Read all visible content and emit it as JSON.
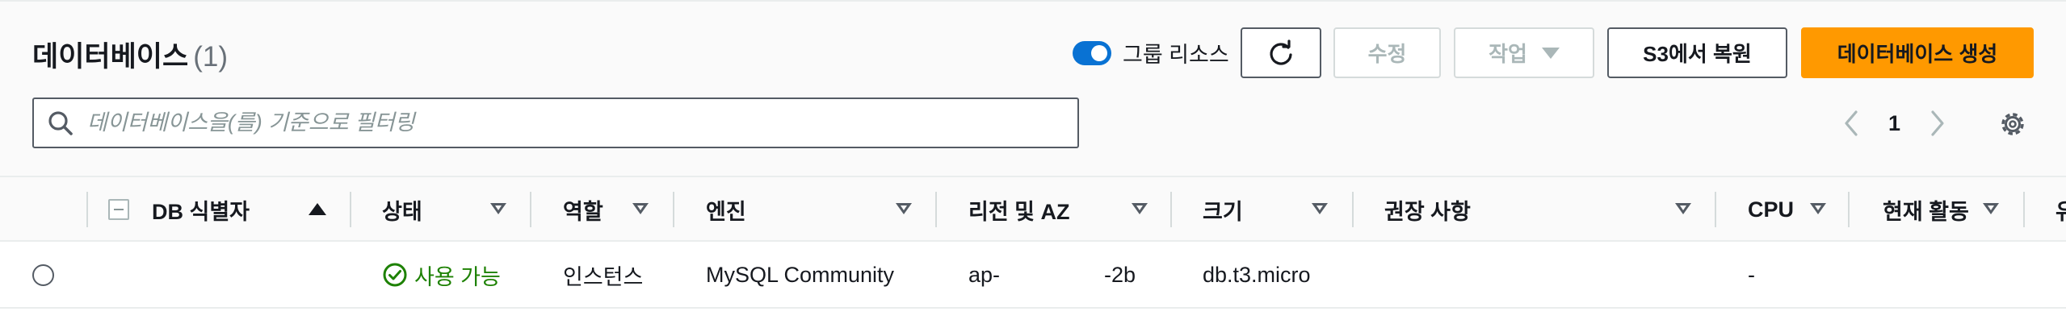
{
  "header": {
    "title": "데이터베이스",
    "count": "(1)",
    "group_toggle_label": "그룹 리소스",
    "refresh_icon": "refresh-icon",
    "modify_label": "수정",
    "actions_label": "작업",
    "restore_s3_label": "S3에서 복원",
    "create_label": "데이터베이스 생성",
    "accent_color": "#ff9900",
    "toggle_color": "#0972d3"
  },
  "search": {
    "placeholder": "데이터베이스을(를) 기준으로 필터링",
    "value": ""
  },
  "pagination": {
    "current_page": "1"
  },
  "table": {
    "columns": [
      "DB 식별자",
      "상태",
      "역할",
      "엔진",
      "리전 및 AZ",
      "크기",
      "권장 사항",
      "CPU",
      "현재 활동",
      "유"
    ],
    "rows": [
      {
        "id": "",
        "status": "사용 가능",
        "role": "인스턴스",
        "engine": "MySQL Community",
        "region_prefix": "ap-",
        "region_suffix": "-2b",
        "size": "db.t3.micro",
        "recommendations": "",
        "cpu": "-",
        "activity": ""
      }
    ]
  },
  "icons": {
    "search": "search-icon",
    "prev": "chevron-left-icon",
    "next": "chevron-right-icon",
    "settings": "gear-icon",
    "status_ok": "check-circle-icon"
  }
}
